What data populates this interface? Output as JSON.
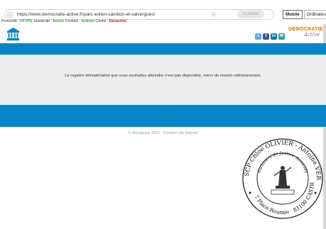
{
  "browser": {
    "url": "https://www.democratie-active.fr/parc-eolien-cambon-et-salvergues/",
    "dot": "0",
    "access_label": "Accéder",
    "mode_mobile": "Mobile",
    "mode_desktop": "Ordinateur"
  },
  "protocol": {
    "protocole_label": "Protocole :",
    "protocole_value": "HTTPS",
    "javascript_label": "Javascript :",
    "javascript_value": "Activé",
    "cookies_label": "Cookies :",
    "cookies_value": "Activés",
    "cache_label": "Cache :",
    "cache_value": "Désactivé"
  },
  "header": {
    "logo_line1": "DEMOCRATIE",
    "logo_line2": "Active",
    "social": [
      "twitter-icon",
      "facebook-icon",
      "linkedin-icon",
      "mail-icon"
    ]
  },
  "main": {
    "message": "Le registre dématérialisé que vous souhaitez atteindre n'est pas disponible, merci de revenir ultérieurement."
  },
  "footer": {
    "text": "© Micropulse 2023 - Création site internet"
  },
  "stamp": {
    "text": "SCP Chloé OLIVIER - Antoine VERGÉ Huissiers de Justice Associés 7 Place Roumie 81100 CASTRES"
  },
  "colors": {
    "brand_blue": "#0a86c8",
    "logo_orange": "#e07a20",
    "active_green": "#2e9c2e",
    "disabled_red": "#cc2222"
  }
}
